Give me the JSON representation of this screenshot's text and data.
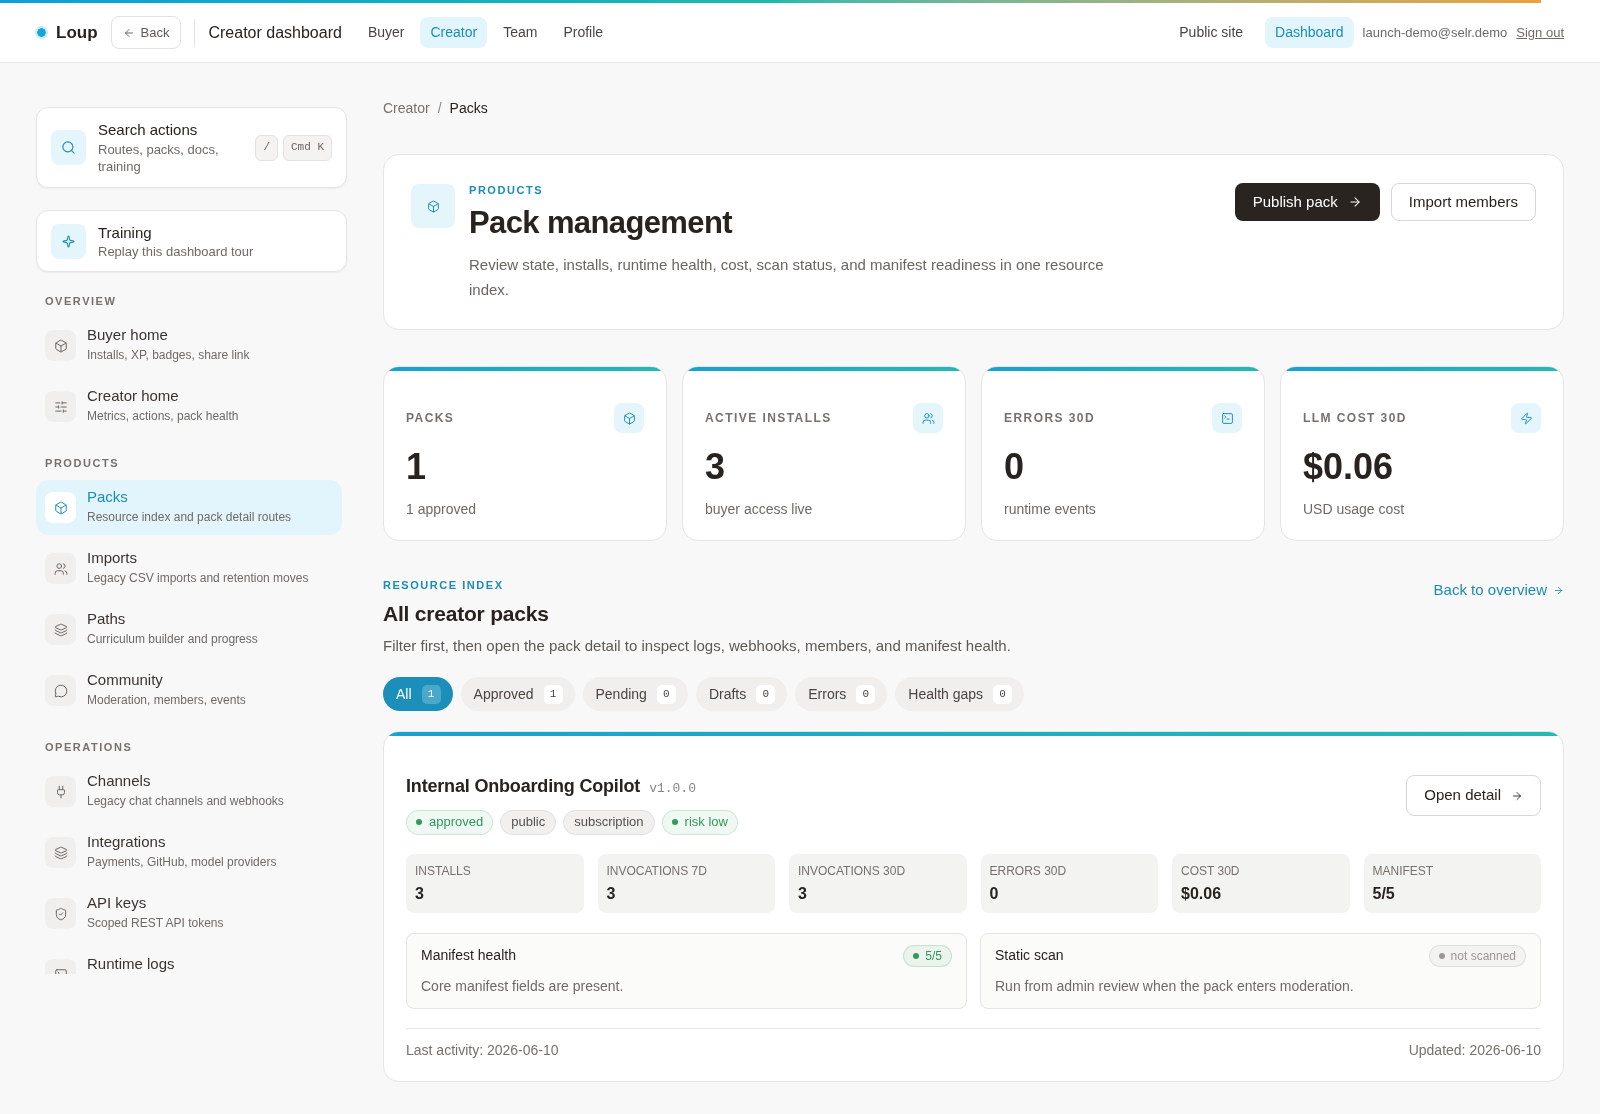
{
  "top_bar": {
    "brand": "Loup",
    "back_label": "Back",
    "title": "Creator dashboard",
    "nav": [
      {
        "label": "Buyer",
        "selected": false
      },
      {
        "label": "Creator",
        "selected": true
      },
      {
        "label": "Team",
        "selected": false
      },
      {
        "label": "Profile",
        "selected": false
      }
    ],
    "right_nav": [
      {
        "label": "Public site",
        "selected": false
      },
      {
        "label": "Dashboard",
        "selected": true
      }
    ],
    "account_email": "launch-demo@selr.demo",
    "sign_out": "Sign out"
  },
  "sidebar": {
    "search": {
      "title": "Search actions",
      "subtitle": "Routes, packs, docs, training",
      "shortcuts": [
        "/",
        "Cmd K"
      ]
    },
    "training": {
      "title": "Training",
      "subtitle": "Replay this dashboard tour"
    },
    "sections": [
      {
        "heading": "OVERVIEW",
        "items": [
          {
            "title": "Buyer home",
            "subtitle": "Installs, XP, badges, share link",
            "selected": false
          },
          {
            "title": "Creator home",
            "subtitle": "Metrics, actions, pack health",
            "selected": false
          }
        ]
      },
      {
        "heading": "PRODUCTS",
        "items": [
          {
            "title": "Packs",
            "subtitle": "Resource index and pack detail routes",
            "selected": true
          },
          {
            "title": "Imports",
            "subtitle": "Legacy CSV imports and retention moves",
            "selected": false
          },
          {
            "title": "Paths",
            "subtitle": "Curriculum builder and progress",
            "selected": false
          },
          {
            "title": "Community",
            "subtitle": "Moderation, members, events",
            "selected": false
          }
        ]
      },
      {
        "heading": "OPERATIONS",
        "items": [
          {
            "title": "Channels",
            "subtitle": "Legacy chat channels and webhooks",
            "selected": false
          },
          {
            "title": "Integrations",
            "subtitle": "Payments, GitHub, model providers",
            "selected": false
          },
          {
            "title": "API keys",
            "subtitle": "Scoped REST API tokens",
            "selected": false
          },
          {
            "title": "Runtime logs",
            "selected": false
          }
        ]
      }
    ]
  },
  "breadcrumb": {
    "items": [
      "Creator",
      "Packs"
    ],
    "separator": "/"
  },
  "header": {
    "eyebrow": "PRODUCTS",
    "title": "Pack management",
    "description": "Review state, installs, runtime health, cost, scan status, and manifest readiness in one resource index.",
    "primary_action": "Publish pack",
    "secondary_action": "Import members"
  },
  "stats": [
    {
      "label": "PACKS",
      "value": "1",
      "caption": "1 approved"
    },
    {
      "label": "ACTIVE INSTALLS",
      "value": "3",
      "caption": "buyer access live"
    },
    {
      "label": "ERRORS 30D",
      "value": "0",
      "caption": "runtime events"
    },
    {
      "label": "LLM COST 30D",
      "value": "$0.06",
      "caption": "USD usage cost"
    }
  ],
  "resource_index": {
    "eyebrow": "RESOURCE INDEX",
    "title": "All creator packs",
    "description": "Filter first, then open the pack detail to inspect logs, webhooks, members, and manifest health.",
    "back_link": "Back to overview",
    "filters": [
      {
        "label": "All",
        "count": "1",
        "selected": true
      },
      {
        "label": "Approved",
        "count": "1",
        "selected": false
      },
      {
        "label": "Pending",
        "count": "0",
        "selected": false
      },
      {
        "label": "Drafts",
        "count": "0",
        "selected": false
      },
      {
        "label": "Errors",
        "count": "0",
        "selected": false
      },
      {
        "label": "Health gaps",
        "count": "0",
        "selected": false
      }
    ]
  },
  "pack": {
    "name": "Internal Onboarding Copilot",
    "version": "v1.0.0",
    "tags": [
      {
        "kind": "status",
        "label": "approved",
        "color": "#2f9a5a"
      },
      {
        "kind": "plain",
        "label": "public"
      },
      {
        "kind": "plain",
        "label": "subscription"
      },
      {
        "kind": "status",
        "label": "risk low",
        "color": "#2f9a5a"
      }
    ],
    "action": "Open detail",
    "metrics": [
      {
        "label": "INSTALLS",
        "value": "3"
      },
      {
        "label": "INVOCATIONS 7D",
        "value": "3"
      },
      {
        "label": "INVOCATIONS 30D",
        "value": "3"
      },
      {
        "label": "ERRORS 30D",
        "value": "0"
      },
      {
        "label": "COST 30D",
        "value": "$0.06"
      },
      {
        "label": "MANIFEST",
        "value": "5/5"
      }
    ],
    "checks": [
      {
        "title": "Manifest health",
        "description": "Core manifest fields are present.",
        "badge": {
          "label": "5/5",
          "color": "#2f9a5a"
        }
      },
      {
        "title": "Static scan",
        "description": "Run from admin review when the pack enters moderation.",
        "badge": {
          "label": "not scanned",
          "color": "#9c9794"
        }
      }
    ],
    "last_activity": "Last activity: 2026-06-10",
    "updated": "Updated: 2026-06-10"
  }
}
